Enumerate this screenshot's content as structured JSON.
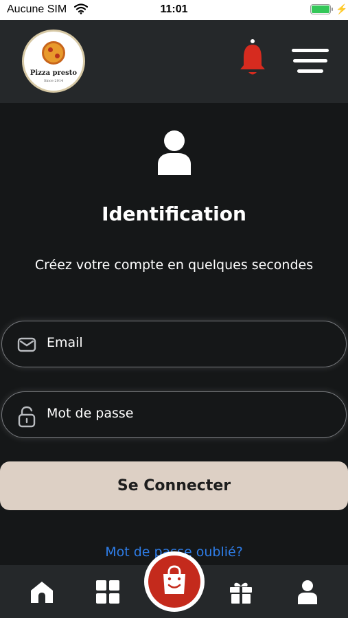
{
  "status_bar": {
    "carrier": "Aucune SIM",
    "time": "11:01",
    "battery_level": 1.0,
    "battery_color": "#34c759"
  },
  "header": {
    "logo": {
      "name": "Pizza presto",
      "since": "Since 2014"
    },
    "bell_color": "#d62b1f",
    "icons": [
      "bell-icon",
      "menu-icon"
    ]
  },
  "main": {
    "title": "Identification",
    "subtitle": "Créez votre compte en quelques secondes",
    "email_label": "Email",
    "password_label": "Mot de passe",
    "login_button": "Se Connecter",
    "forgot_link": "Mot de passe oublié?"
  },
  "bottom_nav": {
    "items": [
      "home-icon",
      "grid-icon",
      "shopping-bag-icon",
      "gift-icon",
      "user-icon"
    ],
    "accent": "#c42a1c"
  },
  "colors": {
    "background": "#151718",
    "header": "#25282a",
    "button": "#ddd0c5",
    "link": "#2e7de8"
  }
}
